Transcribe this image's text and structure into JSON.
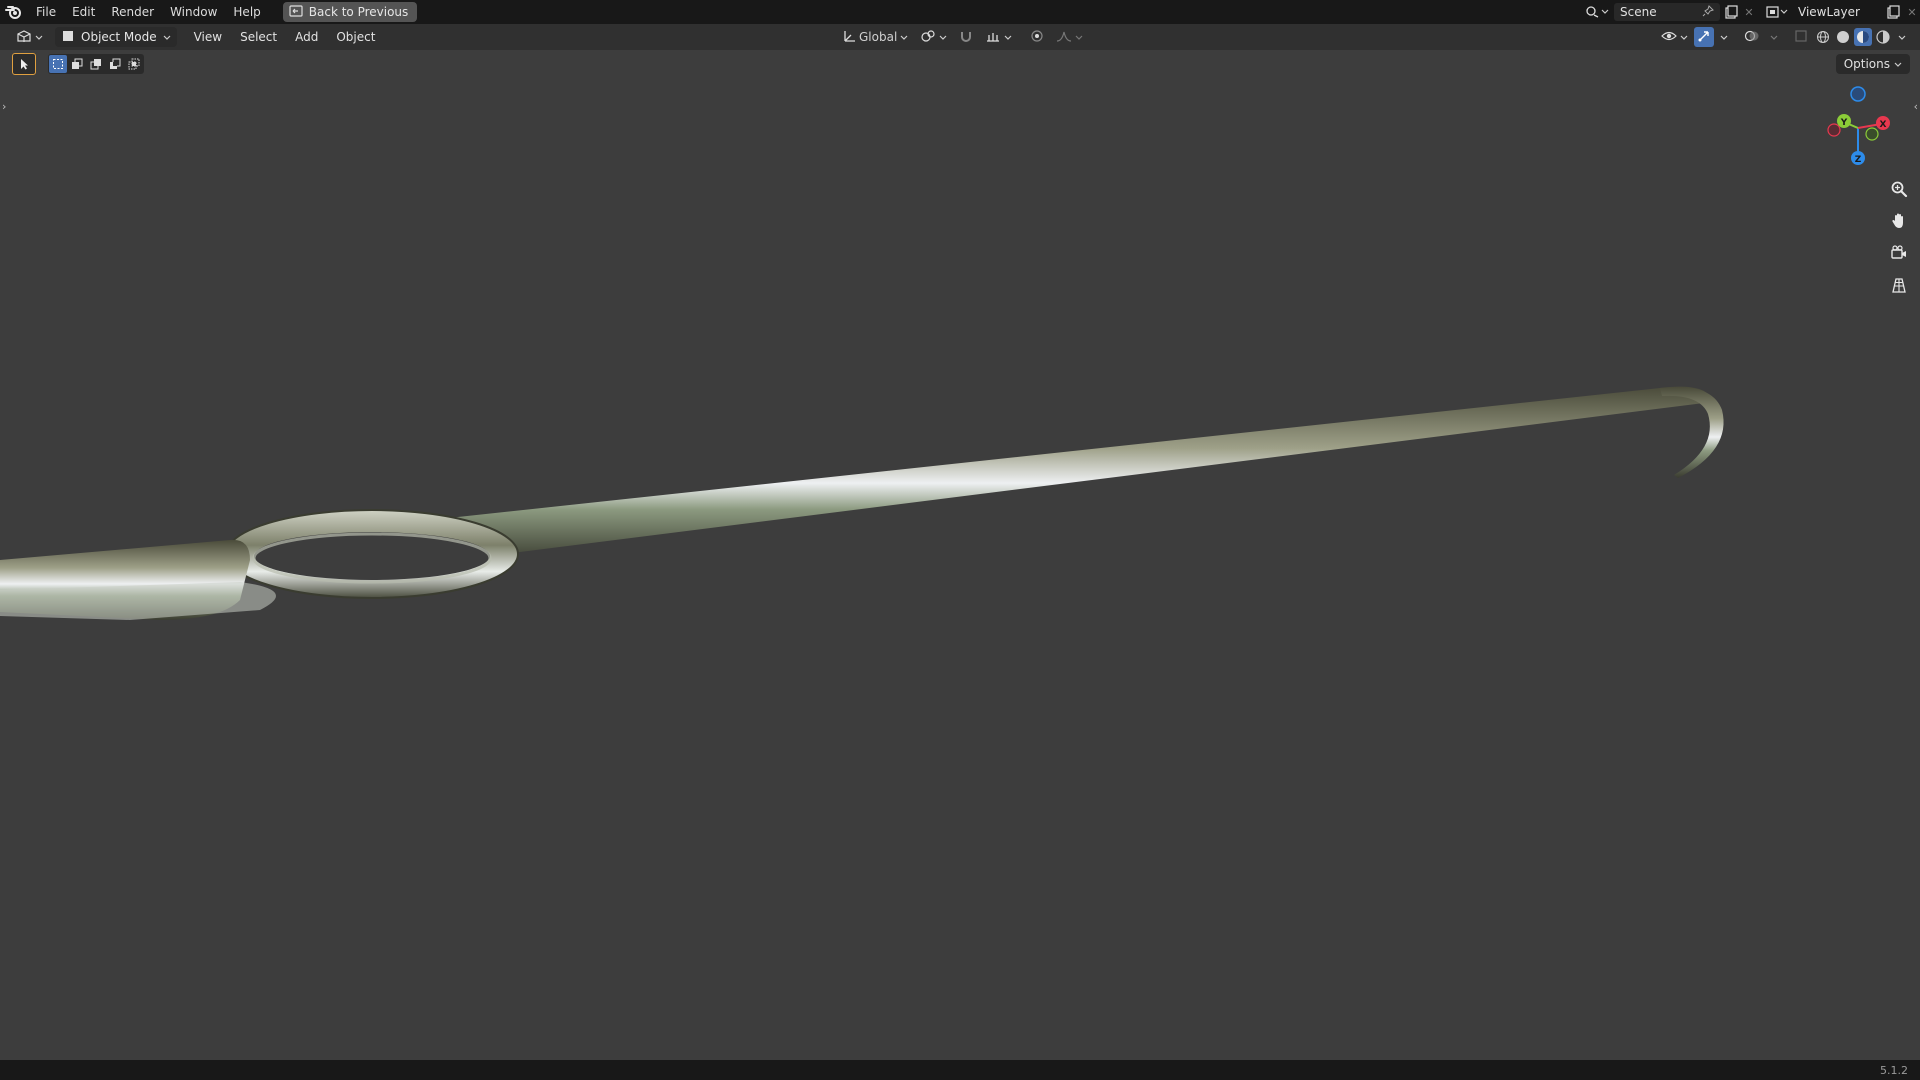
{
  "topbar": {
    "menus": [
      "File",
      "Edit",
      "Render",
      "Window",
      "Help"
    ],
    "back_button": "Back to Previous",
    "scene_name": "Scene",
    "view_layer_name": "ViewLayer"
  },
  "header": {
    "mode_label": "Object Mode",
    "menus": [
      "View",
      "Select",
      "Add",
      "Object"
    ],
    "transform_orientation": "Global"
  },
  "tool_settings": {
    "options_label": "Options"
  },
  "gizmo": {
    "x_label": "X",
    "y_label": "Y",
    "z_label": "Z",
    "x_color": "#e8384f",
    "y_color": "#8bcc38",
    "z_color": "#2d8ceb"
  },
  "status": {
    "version": "5.1.2"
  },
  "colors": {
    "viewport_bg": "#3d3d3d",
    "topbar_bg": "#181818",
    "header_bg": "#303030",
    "accent": "#4772b3"
  }
}
